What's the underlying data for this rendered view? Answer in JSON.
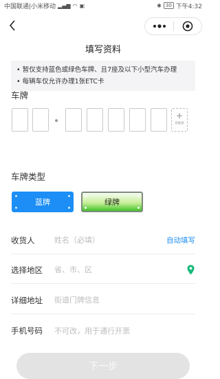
{
  "status_bar": {
    "carriers": "中国联通|小米移动",
    "right_icons": "✱",
    "battery": "30",
    "time": "下午4:32"
  },
  "nav": {
    "more_icon": "more-dots-icon",
    "close_icon": "target-close-icon"
  },
  "page_title": "填写资料",
  "notice": {
    "lines": [
      "• 暂仅支持蓝色或绿色车牌、且7座及以下小型汽车办理",
      "• 每辆车仅允许办理1张ETC卡"
    ]
  },
  "plate": {
    "label": "车牌",
    "new_energy_plus": "+",
    "new_energy_text": "新能源"
  },
  "plate_type": {
    "label": "车牌类型",
    "options": [
      "蓝牌",
      "绿牌"
    ],
    "selected": "蓝牌",
    "colors": {
      "blue": "#1c8ef5",
      "green": "#42c42c"
    }
  },
  "form": {
    "receiver": {
      "label": "收货人",
      "placeholder": "姓名（必填）",
      "value": "",
      "action": "自动填写"
    },
    "region": {
      "label": "选择地区",
      "placeholder": "省、市、区",
      "value": "",
      "icon": "location-pin-icon"
    },
    "address": {
      "label": "详细地址",
      "placeholder": "街道门牌信息",
      "value": ""
    },
    "phone": {
      "label": "手机号码",
      "placeholder": "不可改，用于通行开票",
      "value": ""
    }
  },
  "next_button": "下一步",
  "accent_color": "#1c8ef5",
  "pin_color": "#17b978"
}
